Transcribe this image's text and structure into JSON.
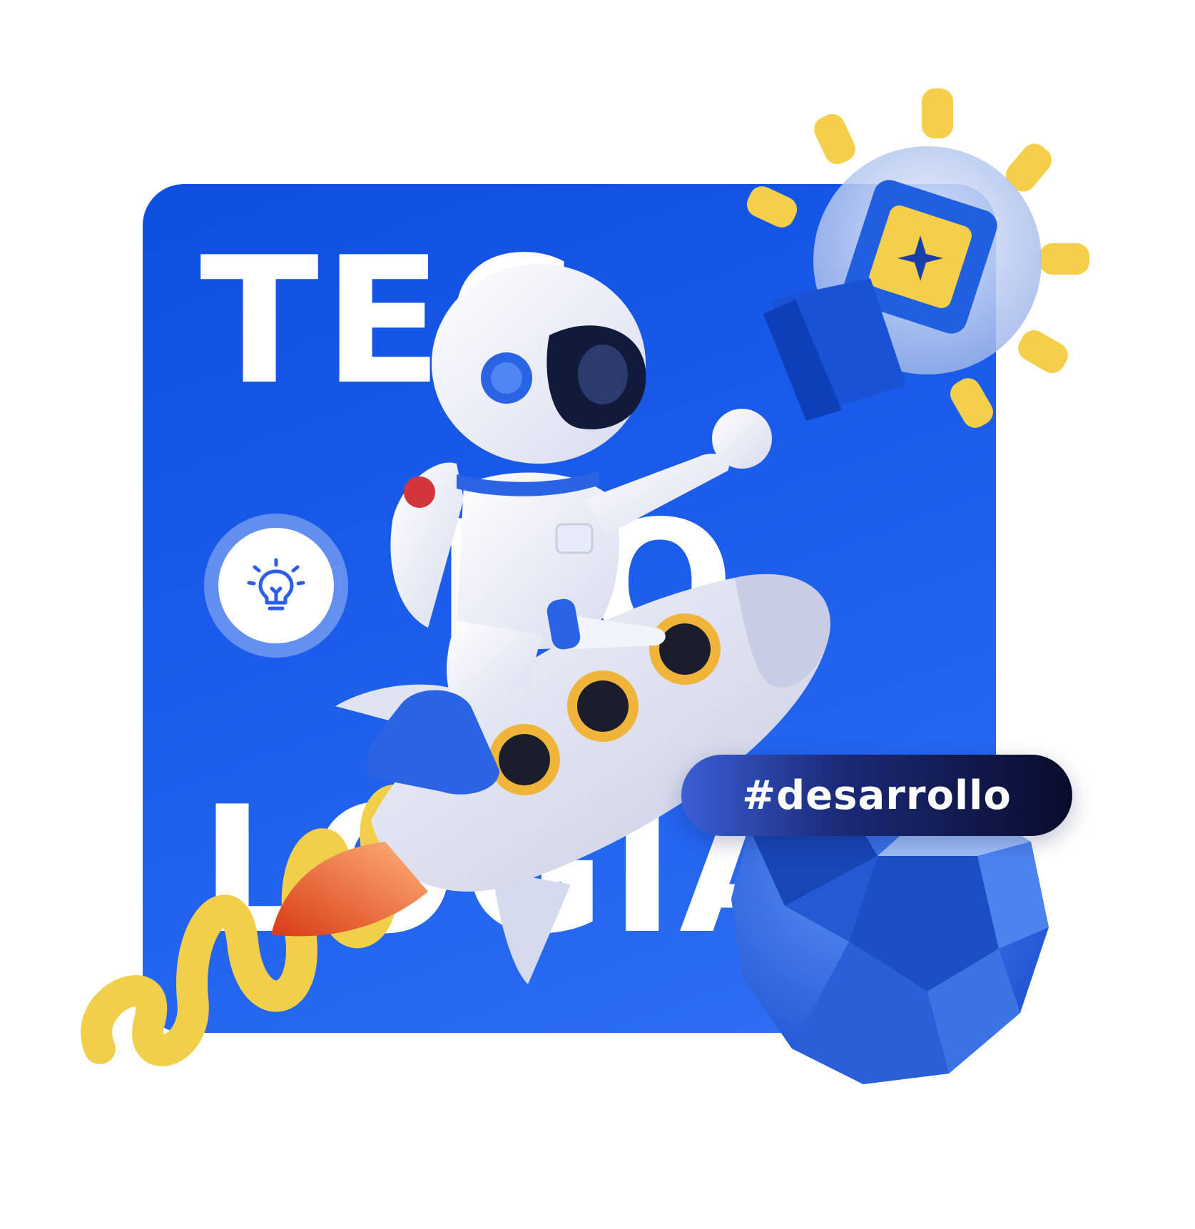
{
  "card": {
    "line1": "TEC",
    "line2": "NO",
    "line3": "LOGIA"
  },
  "badge": {
    "icon": "lightbulb-icon"
  },
  "hashtag": {
    "label": "#desarrollo"
  },
  "decor": {
    "character": "astronaut-riding-rocket",
    "top_right": "lightbulb-with-chip",
    "bottom_right": "faceted-blue-ball",
    "bottom_left": "yellow-squiggle"
  },
  "colors": {
    "brand_blue": "#1e5fec",
    "accent_yellow": "#f5cf4a",
    "pill_dark": "#080c2a"
  }
}
